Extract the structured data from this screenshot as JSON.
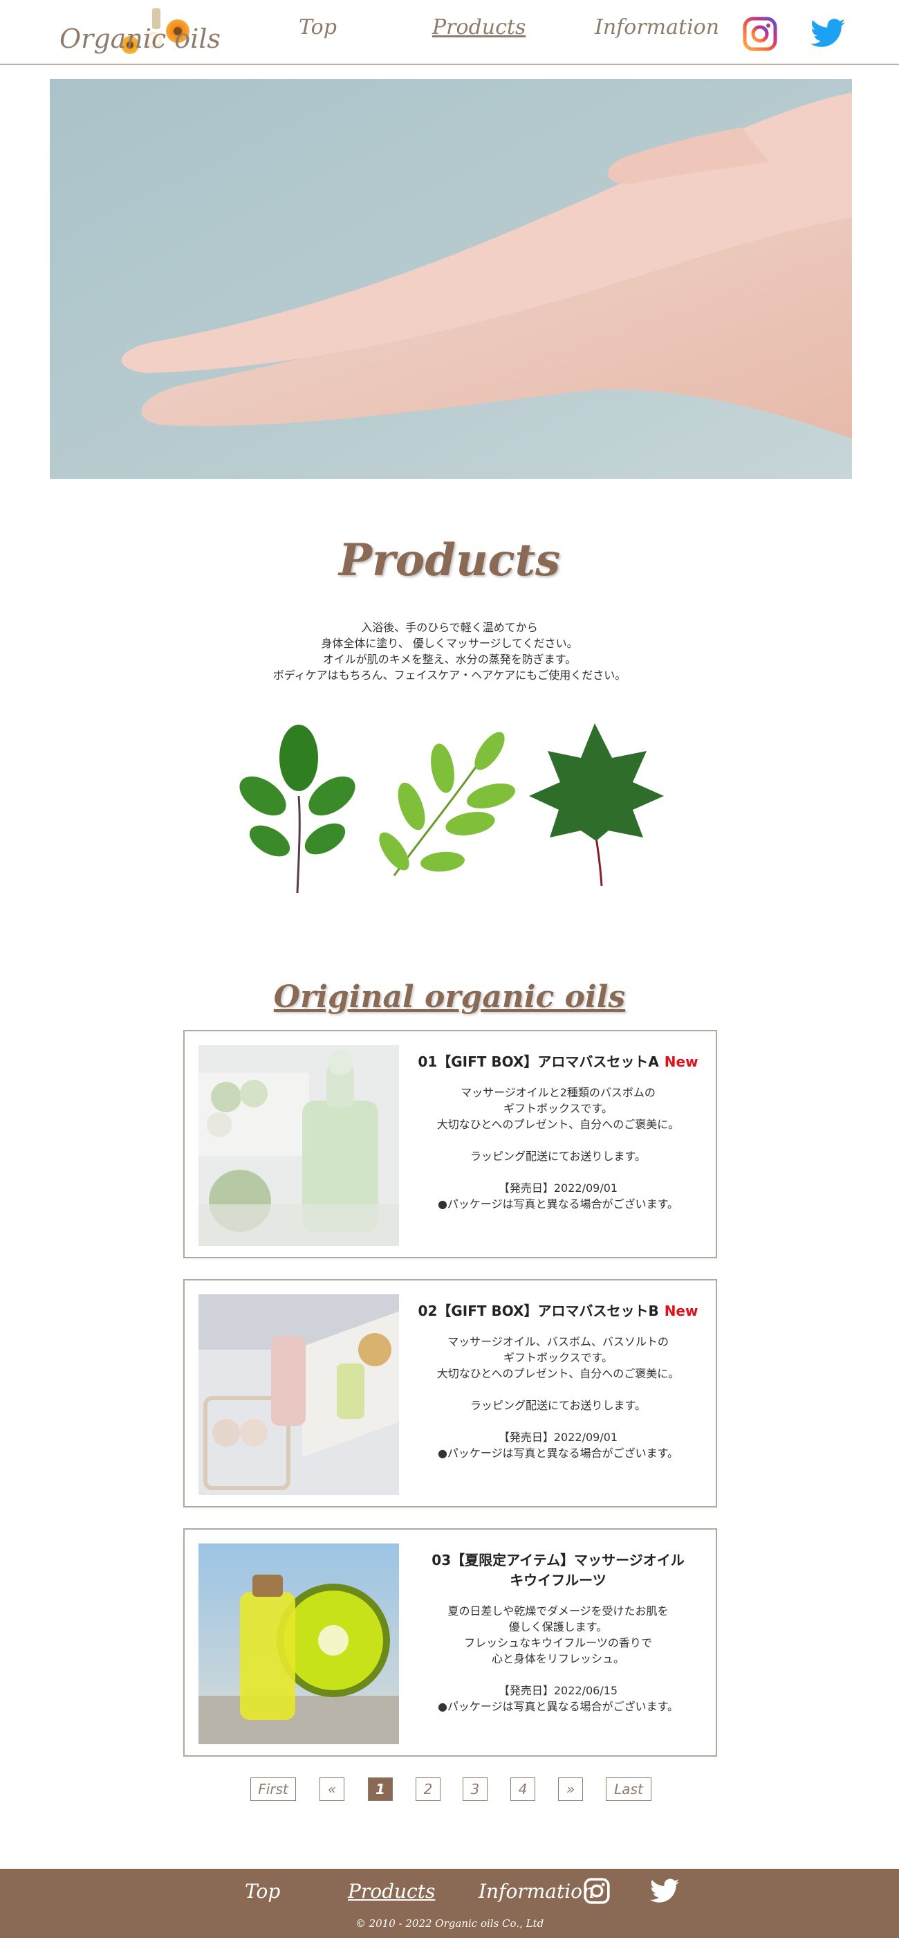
{
  "header": {
    "logo_text": "Organic oils",
    "nav": {
      "top": "Top",
      "products": "Products",
      "information": "Information"
    }
  },
  "products_section": {
    "title": "Products",
    "intro_lines": [
      "入浴後、手のひらで軽く温めてから",
      "身体全体に塗り、 優しくマッサージしてください。",
      "オイルが肌のキメを整え、水分の蒸発を防ぎます。",
      "ボディケアはもちろん、フェイスケア・ヘアケアにもご使用ください。"
    ]
  },
  "oils_section": {
    "title": "Original organic oils",
    "items": [
      {
        "title": "01【GIFT BOX】アロマバスセットA",
        "title_line2": "",
        "badge": "New",
        "desc_lines": [
          "マッサージオイルと2種類のバスボムの",
          "ギフトボックスです。",
          "大切なひとへのプレゼント、自分へのご褒美に。"
        ],
        "note": "ラッピング配送にてお送りします。",
        "release": "【発売日】2022/09/01",
        "caution": "●パッケージは写真と異なる場合がございます。"
      },
      {
        "title": "02【GIFT BOX】アロマバスセットB",
        "title_line2": "",
        "badge": "New",
        "desc_lines": [
          "マッサージオイル、バスボム、バスソルトの",
          "ギフトボックスです。",
          "大切なひとへのプレゼント、自分へのご褒美に。"
        ],
        "note": "ラッピング配送にてお送りします。",
        "release": "【発売日】2022/09/01",
        "caution": "●パッケージは写真と異なる場合がございます。"
      },
      {
        "title": "03【夏限定アイテム】マッサージオイル",
        "title_line2": "キウイフルーツ",
        "badge": "",
        "desc_lines": [
          "夏の日差しや乾燥でダメージを受けたお肌を",
          "優しく保護します。",
          "フレッシュなキウイフルーツの香りで",
          "心と身体をリフレッシュ。"
        ],
        "note": "",
        "release": "【発売日】2022/06/15",
        "caution": "●パッケージは写真と異なる場合がございます。"
      }
    ]
  },
  "pagination": {
    "first": "First",
    "prev": "«",
    "pages": [
      "1",
      "2",
      "3",
      "4"
    ],
    "current": "1",
    "next": "»",
    "last": "Last"
  },
  "footer": {
    "nav": {
      "top": "Top",
      "products": "Products",
      "information": "Information"
    },
    "copyright": "© 2010 - 2022 Organic oils Co., Ltd"
  },
  "colors": {
    "brand_brown": "#8a6a55",
    "nav_text": "#8f7b6a",
    "new_red": "#e0111b",
    "twitter_blue": "#1da1f2"
  },
  "icons": [
    "instagram-icon",
    "twitter-icon"
  ]
}
